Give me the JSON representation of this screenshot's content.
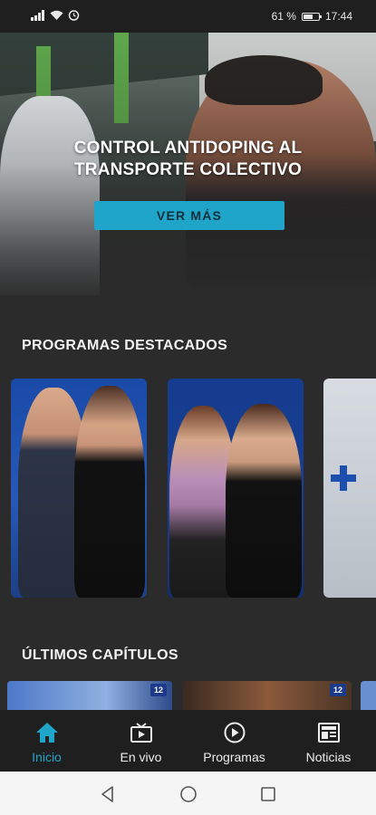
{
  "status_bar": {
    "battery_percent": "61 %",
    "battery_level": 0.61,
    "time": "17:44",
    "icons": [
      "signal-icon",
      "wifi-icon",
      "alarm-icon",
      "battery-icon"
    ]
  },
  "hero": {
    "title_line1": "CONTROL ANTIDOPING AL",
    "title_line2": "TRANSPORTE COLECTIVO",
    "button_label": "VER MÁS"
  },
  "sections": {
    "featured_title": "PROGRAMAS DESTACADOS",
    "latest_title": "ÚLTIMOS CAPÍTULOS"
  },
  "episodes": [
    {
      "badge": "12"
    },
    {
      "badge": "12"
    }
  ],
  "bottom_nav": {
    "items": [
      {
        "label": "Inicio",
        "icon": "home-icon",
        "active": true
      },
      {
        "label": "En vivo",
        "icon": "tv-icon",
        "active": false
      },
      {
        "label": "Programas",
        "icon": "play-circle-icon",
        "active": false
      },
      {
        "label": "Noticias",
        "icon": "newspaper-icon",
        "active": false
      }
    ]
  },
  "colors": {
    "accent": "#1fa5c9",
    "background": "#2b2b2b",
    "nav_background": "#1f1f1f"
  }
}
